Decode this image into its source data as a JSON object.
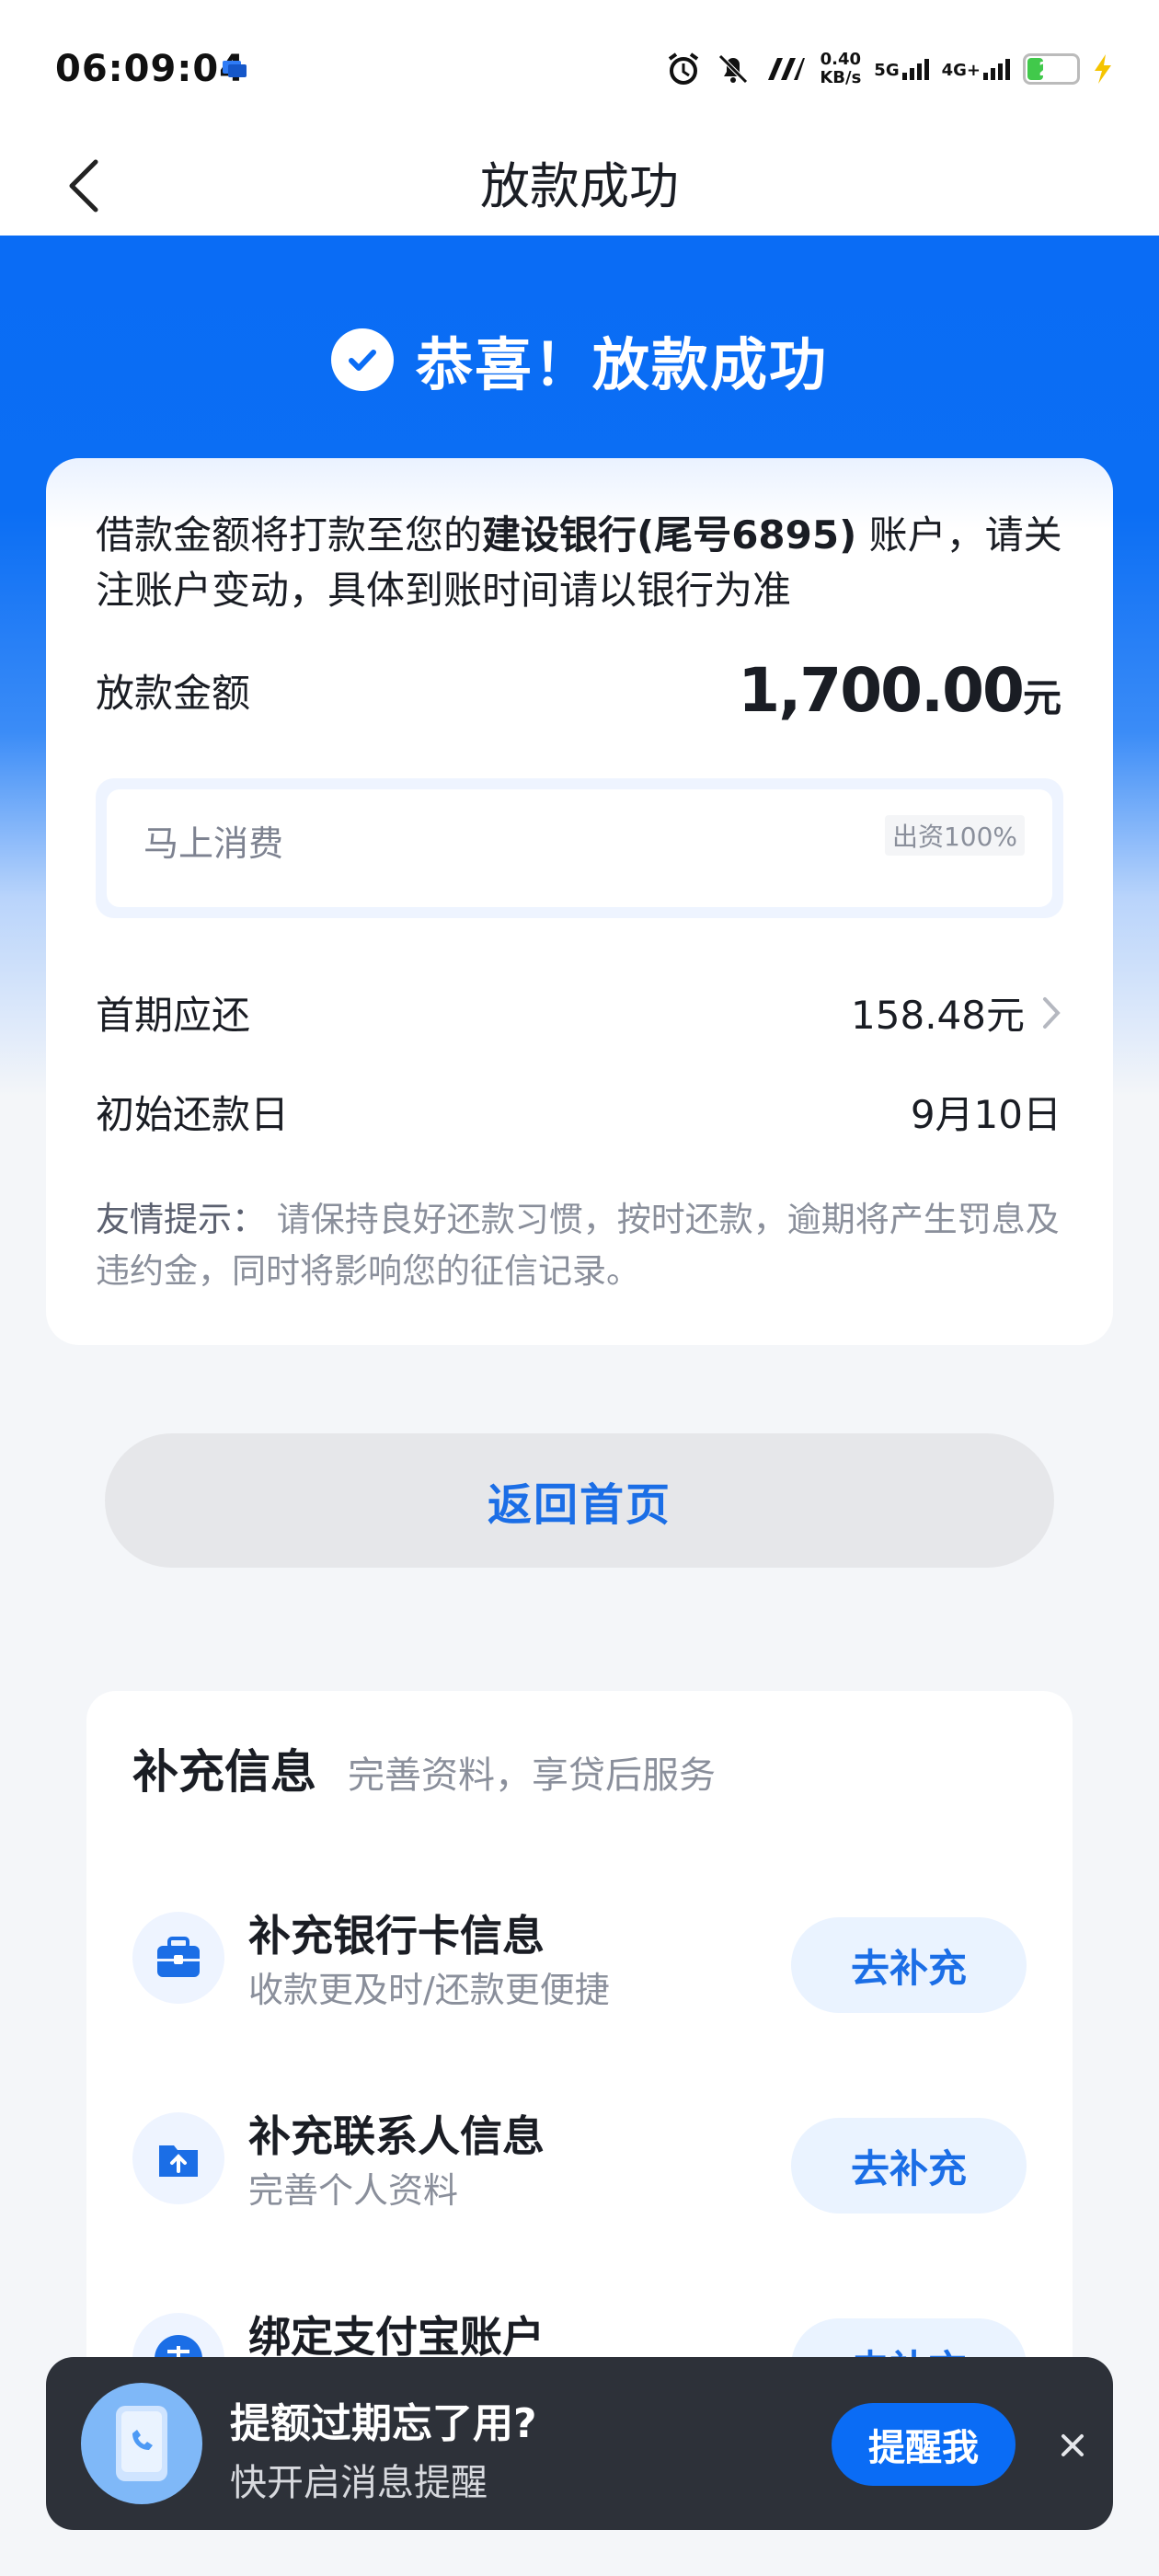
{
  "status_bar": {
    "time": "06:09:04",
    "net_speed_value": "0.40",
    "net_speed_unit": "KB/s",
    "sig1": "5G",
    "sig2": "4G+",
    "battery": "27"
  },
  "nav": {
    "title": "放款成功"
  },
  "hero": {
    "title": "恭喜！放款成功"
  },
  "card": {
    "notice_prefix": "借款金额将打款至您的",
    "notice_bank": "建设银行(尾号6895)",
    "notice_suffix": " 账户，请关注账户变动，具体到账时间请以银行为准",
    "amount_label": "放款金额",
    "amount": "1,700.00",
    "amount_unit": "元",
    "lender_name": "马上消费",
    "lender_badge": "出资100%",
    "first_label": "首期应还",
    "first_value": "158.48元",
    "date_label": "初始还款日",
    "date_value": "9月10日",
    "tip_label": "友情提示：",
    "tip_text": " 请保持良好还款习惯，按时还款，逾期将产生罚息及违约金，同时将影响您的征信记录。"
  },
  "home_button": "返回首页",
  "supplement": {
    "title": "补充信息",
    "subtitle": "完善资料，享贷后服务",
    "items": [
      {
        "title": "补充银行卡信息",
        "sub": "收款更及时/还款更便捷",
        "action": "去补充",
        "icon": "briefcase-icon"
      },
      {
        "title": "补充联系人信息",
        "sub": "完善个人资料",
        "action": "去补充",
        "icon": "upload-icon"
      },
      {
        "title": "绑定支付宝账户",
        "sub": "",
        "action": "去补充",
        "icon": "alipay-icon"
      }
    ]
  },
  "toast": {
    "title": "提额过期忘了用?",
    "sub": "快开启消息提醒",
    "button": "提醒我"
  },
  "colors": {
    "primary": "#0a6cf5",
    "dark_toast": "#2d3139"
  }
}
